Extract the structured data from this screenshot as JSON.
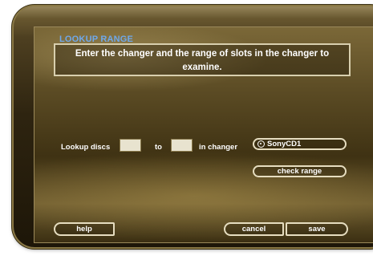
{
  "dialog": {
    "title": "LOOKUP RANGE",
    "instruction": "Enter the changer and the range of slots in the changer to examine."
  },
  "lookup": {
    "label_prefix": "Lookup discs",
    "from_value": "",
    "label_to": "to",
    "to_value": "",
    "label_changer": "in changer",
    "changer_value": "SonyCD1",
    "check_range_label": "check range"
  },
  "footer": {
    "help_label": "help",
    "cancel_label": "cancel",
    "save_label": "save"
  },
  "colors": {
    "title": "#6fa8ea",
    "panel": "#5b4b24",
    "border": "#e6ddc0"
  },
  "icons": {
    "changer": "disc-icon"
  }
}
